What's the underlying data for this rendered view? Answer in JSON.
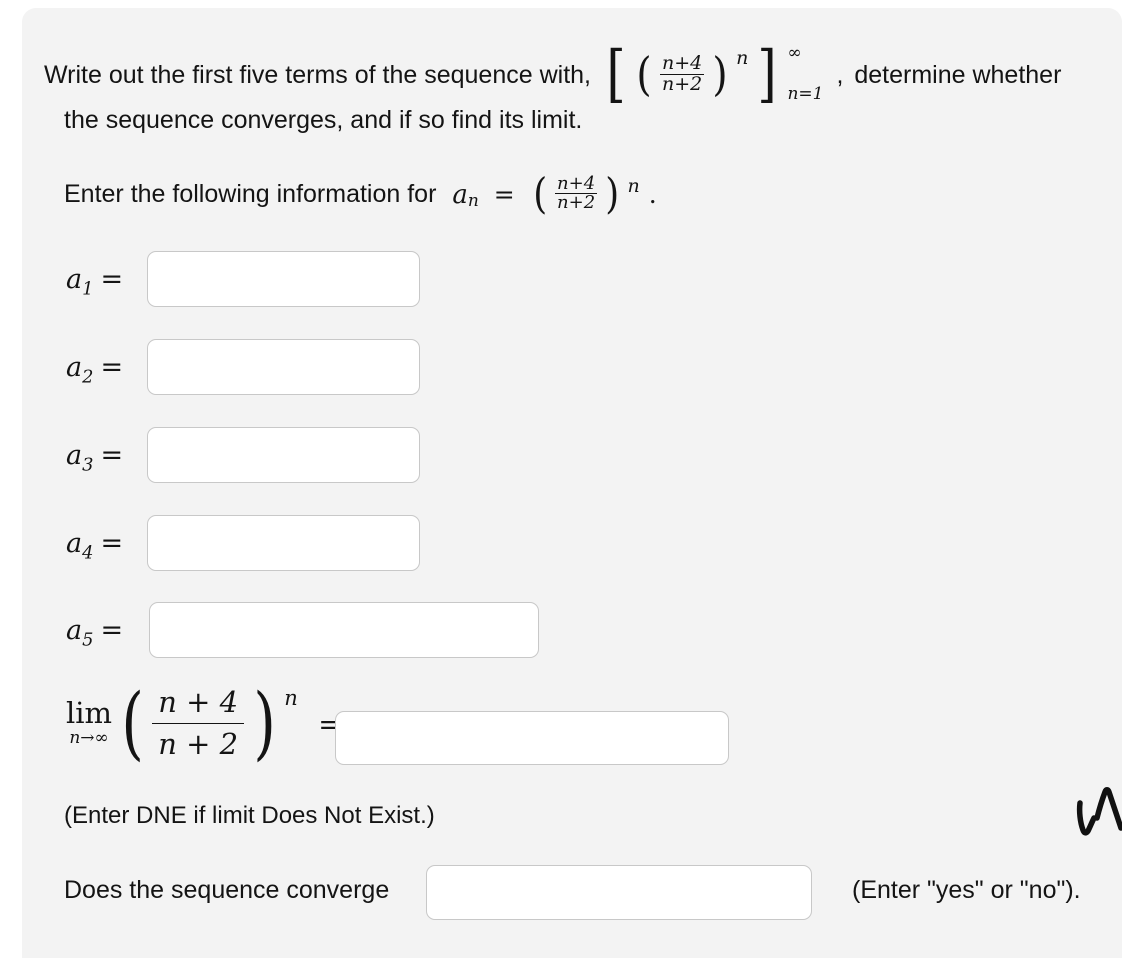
{
  "problem": {
    "statement_part1": "Write out the first five terms of the sequence with,",
    "statement_part2": "determine whether",
    "statement_line2": "the sequence converges, and if so find its limit.",
    "sequence_expression": {
      "open_bracket": "[",
      "open_paren": "(",
      "numerator": "n+4",
      "denominator": "n+2",
      "close_paren": ")",
      "exponent": "n",
      "close_bracket": "]",
      "upper_limit": "∞",
      "lower_limit": "n=1"
    },
    "instruction_prefix": "Enter the following information for",
    "an_symbol": "a",
    "an_subscript": "n",
    "an_equals": "=",
    "an_numerator": "n+4",
    "an_denominator": "n+2",
    "an_exponent": "n",
    "an_period": "."
  },
  "answers": [
    {
      "symbol": "a",
      "index": "1",
      "equals": "=",
      "value": "",
      "placeholder": ""
    },
    {
      "symbol": "a",
      "index": "2",
      "equals": "=",
      "value": "",
      "placeholder": ""
    },
    {
      "symbol": "a",
      "index": "3",
      "equals": "=",
      "value": "",
      "placeholder": ""
    },
    {
      "symbol": "a",
      "index": "4",
      "equals": "=",
      "value": "",
      "placeholder": ""
    },
    {
      "symbol": "a",
      "index": "5",
      "equals": "=",
      "value": "",
      "placeholder": ""
    }
  ],
  "limit_row": {
    "lim_text": "lim",
    "lim_under": "n→∞",
    "open_paren": "(",
    "numerator": "n + 4",
    "denominator": "n + 2",
    "close_paren": ")",
    "exponent": "n",
    "equals": "=",
    "value": "",
    "placeholder": ""
  },
  "notes": {
    "dne": "(Enter DNE if limit Does Not Exist.)",
    "converge_question": "Does the sequence converge",
    "yes_no_hint": "(Enter \"yes\" or \"no\")."
  },
  "converge_answer": {
    "value": "",
    "placeholder": ""
  },
  "annotation": {
    "name": "hand-drawn-check-mark"
  },
  "colors": {
    "page_background": "#ffffff",
    "card_background": "#f3f3f3",
    "text": "#141414",
    "field_background": "#ffffff",
    "field_border": "#c8c8c8",
    "annotation_ink": "#111111"
  }
}
